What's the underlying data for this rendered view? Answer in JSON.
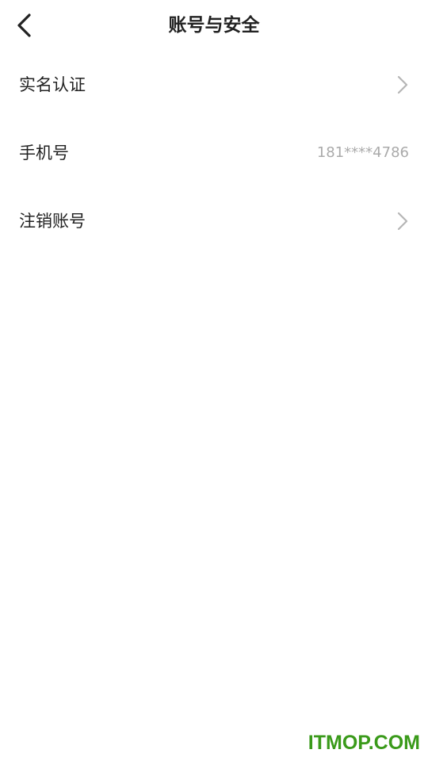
{
  "header": {
    "title": "账号与安全",
    "back_icon": "chevron-left-icon"
  },
  "menu": [
    {
      "label": "实名认证",
      "value": "",
      "trailing_icon": "chevron-right-icon"
    },
    {
      "label": "手机号",
      "value": "181****4786",
      "trailing_icon": ""
    },
    {
      "label": "注销账号",
      "value": "",
      "trailing_icon": "chevron-right-icon"
    }
  ],
  "watermark": "ITMOP.COM",
  "colors": {
    "text_primary": "#222222",
    "text_secondary": "#aaaaaa",
    "chevron": "#b5b5b5",
    "watermark": "#3a9a1a",
    "background": "#ffffff"
  }
}
